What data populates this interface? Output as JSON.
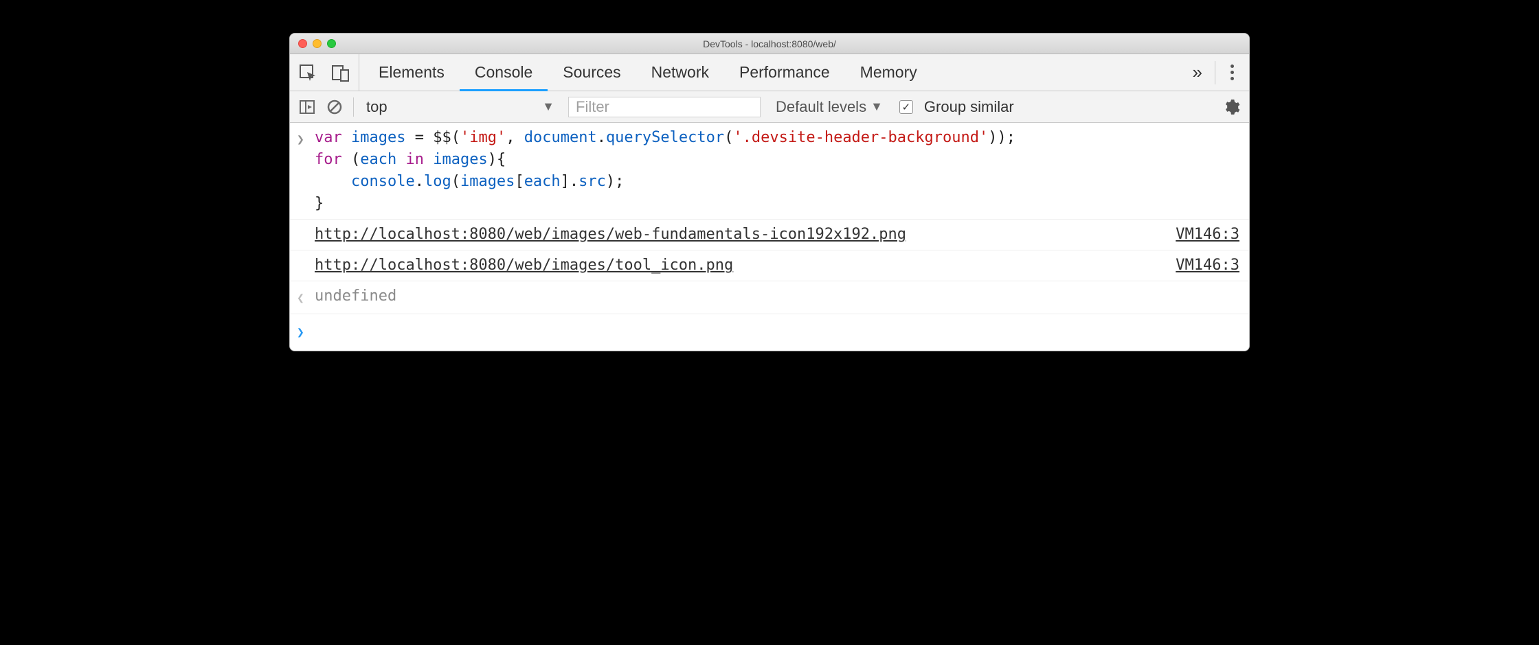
{
  "window": {
    "title": "DevTools - localhost:8080/web/"
  },
  "tabs": {
    "elements": "Elements",
    "console": "Console",
    "sources": "Sources",
    "network": "Network",
    "performance": "Performance",
    "memory": "Memory"
  },
  "subbar": {
    "context": "top",
    "filter_placeholder": "Filter",
    "levels_label": "Default levels",
    "group_similar_label": "Group similar",
    "group_similar_checked": true
  },
  "console": {
    "input_code_tokens": [
      {
        "t": "kw",
        "v": "var"
      },
      {
        "t": "sp",
        "v": " "
      },
      {
        "t": "var",
        "v": "images"
      },
      {
        "t": "sp",
        "v": " "
      },
      {
        "t": "op",
        "v": "="
      },
      {
        "t": "sp",
        "v": " "
      },
      {
        "t": "punct",
        "v": "$$("
      },
      {
        "t": "str",
        "v": "'img'"
      },
      {
        "t": "punct",
        "v": ", "
      },
      {
        "t": "var",
        "v": "document"
      },
      {
        "t": "punct",
        "v": "."
      },
      {
        "t": "var",
        "v": "querySelector"
      },
      {
        "t": "punct",
        "v": "("
      },
      {
        "t": "str",
        "v": "'.devsite-header-background'"
      },
      {
        "t": "punct",
        "v": "));"
      },
      {
        "t": "nl",
        "v": "\n"
      },
      {
        "t": "kw",
        "v": "for"
      },
      {
        "t": "sp",
        "v": " "
      },
      {
        "t": "punct",
        "v": "("
      },
      {
        "t": "var",
        "v": "each"
      },
      {
        "t": "sp",
        "v": " "
      },
      {
        "t": "kw",
        "v": "in"
      },
      {
        "t": "sp",
        "v": " "
      },
      {
        "t": "var",
        "v": "images"
      },
      {
        "t": "punct",
        "v": "){"
      },
      {
        "t": "nl",
        "v": "\n"
      },
      {
        "t": "sp",
        "v": "    "
      },
      {
        "t": "var",
        "v": "console"
      },
      {
        "t": "punct",
        "v": "."
      },
      {
        "t": "var",
        "v": "log"
      },
      {
        "t": "punct",
        "v": "("
      },
      {
        "t": "var",
        "v": "images"
      },
      {
        "t": "punct",
        "v": "["
      },
      {
        "t": "var",
        "v": "each"
      },
      {
        "t": "punct",
        "v": "]."
      },
      {
        "t": "var",
        "v": "src"
      },
      {
        "t": "punct",
        "v": ");"
      },
      {
        "t": "nl",
        "v": "\n"
      },
      {
        "t": "punct",
        "v": "}"
      }
    ],
    "logs": [
      {
        "message": "http://localhost:8080/web/images/web-fundamentals-icon192x192.png",
        "source": "VM146:3"
      },
      {
        "message": "http://localhost:8080/web/images/tool_icon.png",
        "source": "VM146:3"
      }
    ],
    "return_value": "undefined"
  },
  "glyphs": {
    "input": "❯",
    "output": "❮",
    "prompt": "❯",
    "dropdown": "▼",
    "check": "✓"
  }
}
